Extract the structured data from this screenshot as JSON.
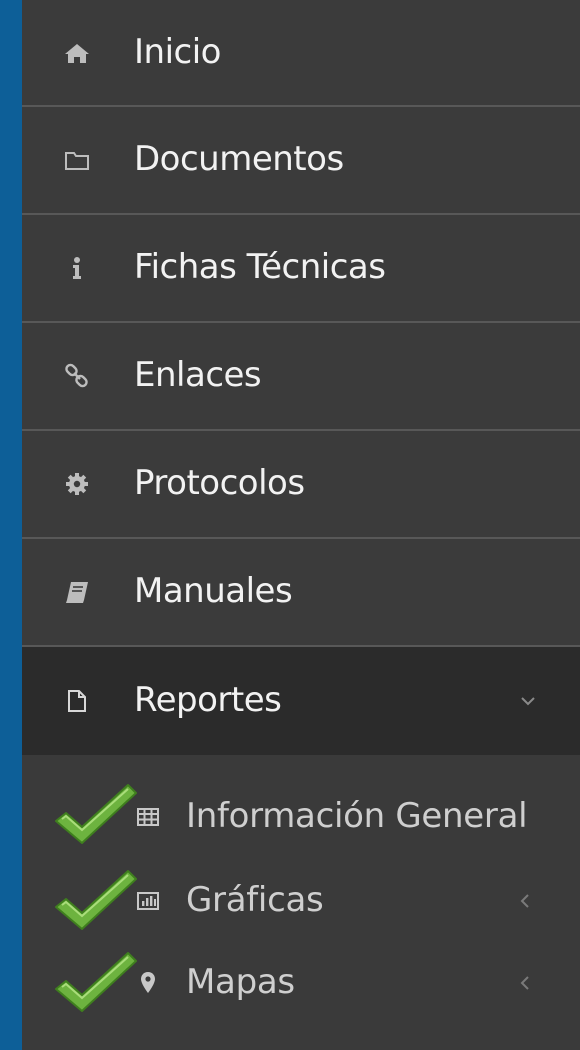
{
  "sidebar": {
    "items": [
      {
        "label": "Inicio",
        "icon": "home-icon"
      },
      {
        "label": "Documentos",
        "icon": "folder-icon"
      },
      {
        "label": "Fichas Técnicas",
        "icon": "info-icon"
      },
      {
        "label": "Enlaces",
        "icon": "link-icon"
      },
      {
        "label": "Protocolos",
        "icon": "gear-icon"
      },
      {
        "label": "Manuales",
        "icon": "book-icon"
      },
      {
        "label": "Reportes",
        "icon": "file-icon",
        "expanded": true
      }
    ],
    "submenu": [
      {
        "label": "Información General",
        "icon": "table-icon",
        "checked": true
      },
      {
        "label": "Gráficas",
        "icon": "bar-chart-icon",
        "checked": true,
        "has_children": true
      },
      {
        "label": "Mapas",
        "icon": "map-marker-icon",
        "checked": true,
        "has_children": true
      }
    ]
  },
  "colors": {
    "frame_blue": "#0d5f98",
    "sidebar_bg": "#3b3b3b",
    "active_bg": "#2b2b2b",
    "divider": "#585858",
    "check_green": "#6db33f"
  }
}
